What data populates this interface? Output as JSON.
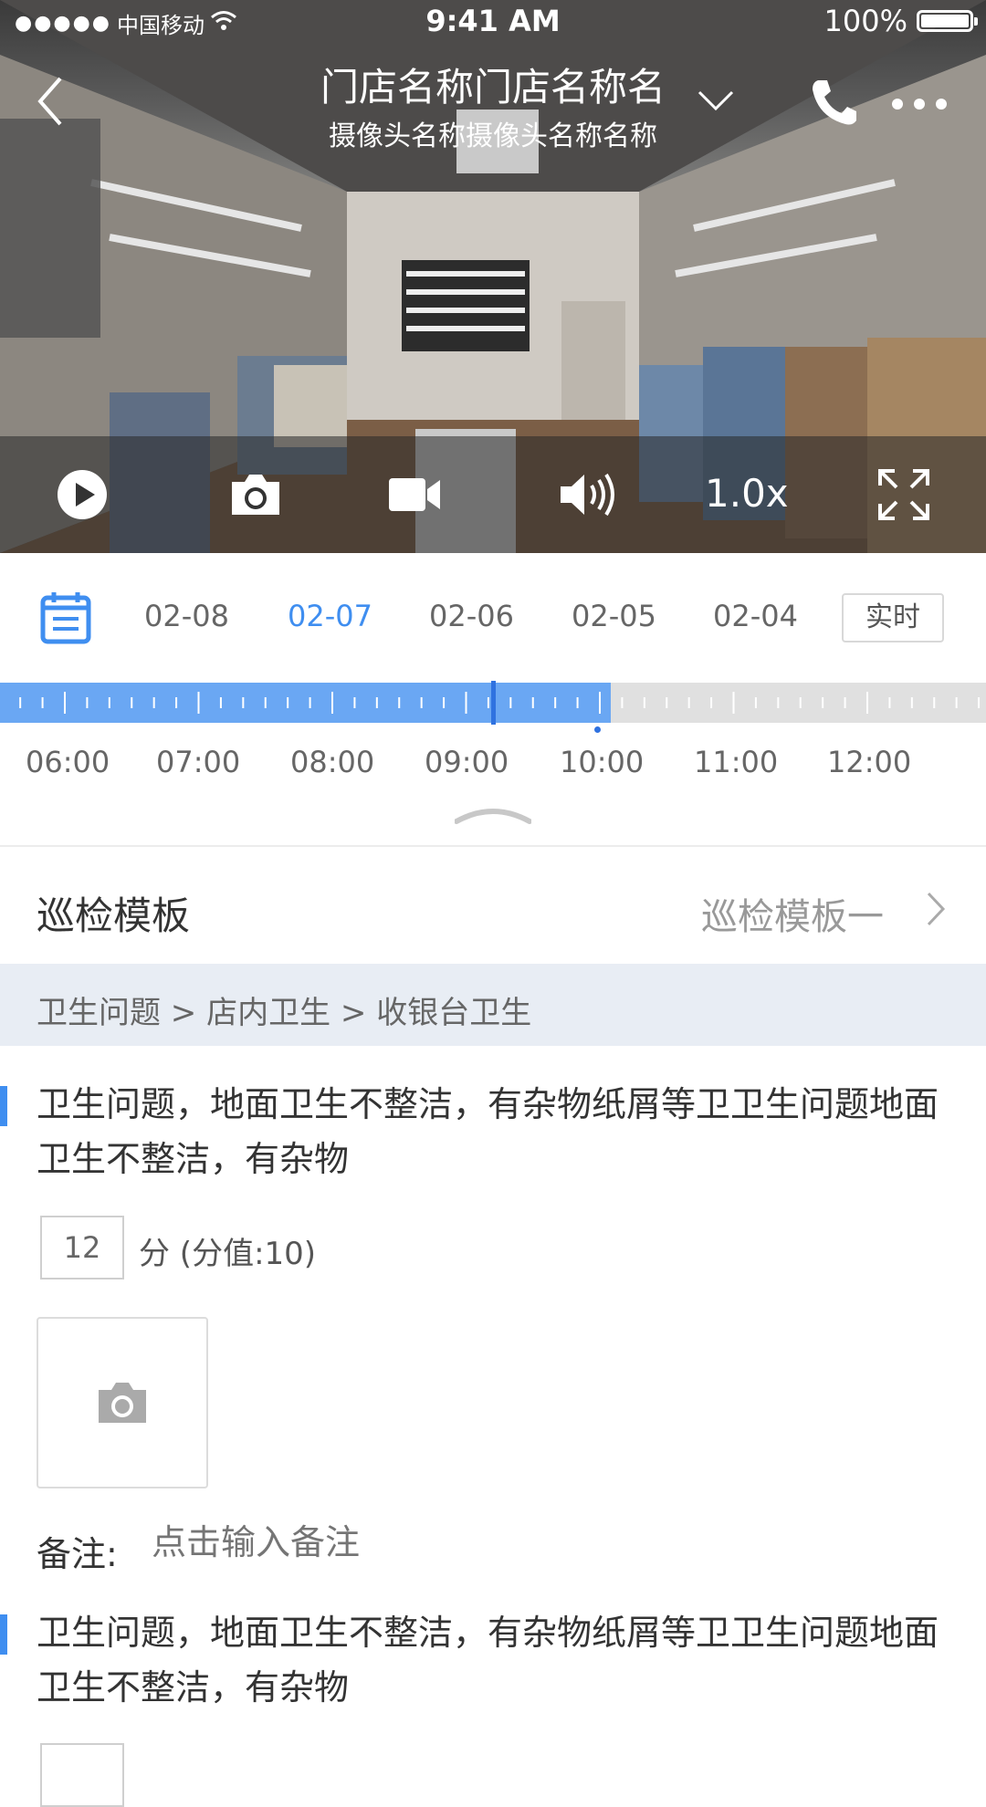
{
  "status_bar": {
    "signal_dots": "●●●●●",
    "carrier": "中国移动",
    "wifi_icon": "wifi-icon",
    "time": "9:41 AM",
    "battery_text": "100%",
    "battery_level": 1.0
  },
  "nav": {
    "title": "门店名称门店名称名",
    "subtitle": "摄像头名称摄像头名称名称",
    "back_icon": "chevron-left-icon",
    "dropdown_icon": "chevron-down-icon",
    "phone_icon": "phone-icon",
    "more_icon": "more-icon"
  },
  "controls": {
    "play_icon": "play-icon",
    "snapshot_icon": "camera-icon",
    "record_icon": "video-camera-icon",
    "volume_icon": "volume-icon",
    "speed": "1.0x",
    "fullscreen_icon": "fullscreen-icon"
  },
  "dates": {
    "calendar_icon": "calendar-icon",
    "items": [
      "02-08",
      "02-07",
      "02-06",
      "02-05",
      "02-04"
    ],
    "active": "02-07",
    "realtime_label": "实时"
  },
  "timeline": {
    "labels": [
      "06:00",
      "07:00",
      "08:00",
      "09:00",
      "10:00",
      "11:00",
      "12:00"
    ],
    "played_until": "10:05",
    "cursor_at": "09:12",
    "accent_color": "#3f8ef0"
  },
  "template": {
    "label": "巡检模板",
    "value": "巡检模板一"
  },
  "breadcrumb": "卫生问题 > 店内卫生 > 收银台卫生",
  "items": [
    {
      "text": "卫生问题，地面卫生不整洁，有杂物纸屑等卫卫生问题地面卫生不整洁，有杂物",
      "score": "12",
      "score_suffix": "分 (分值:10)",
      "remark_label": "备注:",
      "remark_placeholder": "点击输入备注"
    },
    {
      "text": "卫生问题，地面卫生不整洁，有杂物纸屑等卫卫生问题地面卫生不整洁，有杂物"
    }
  ]
}
